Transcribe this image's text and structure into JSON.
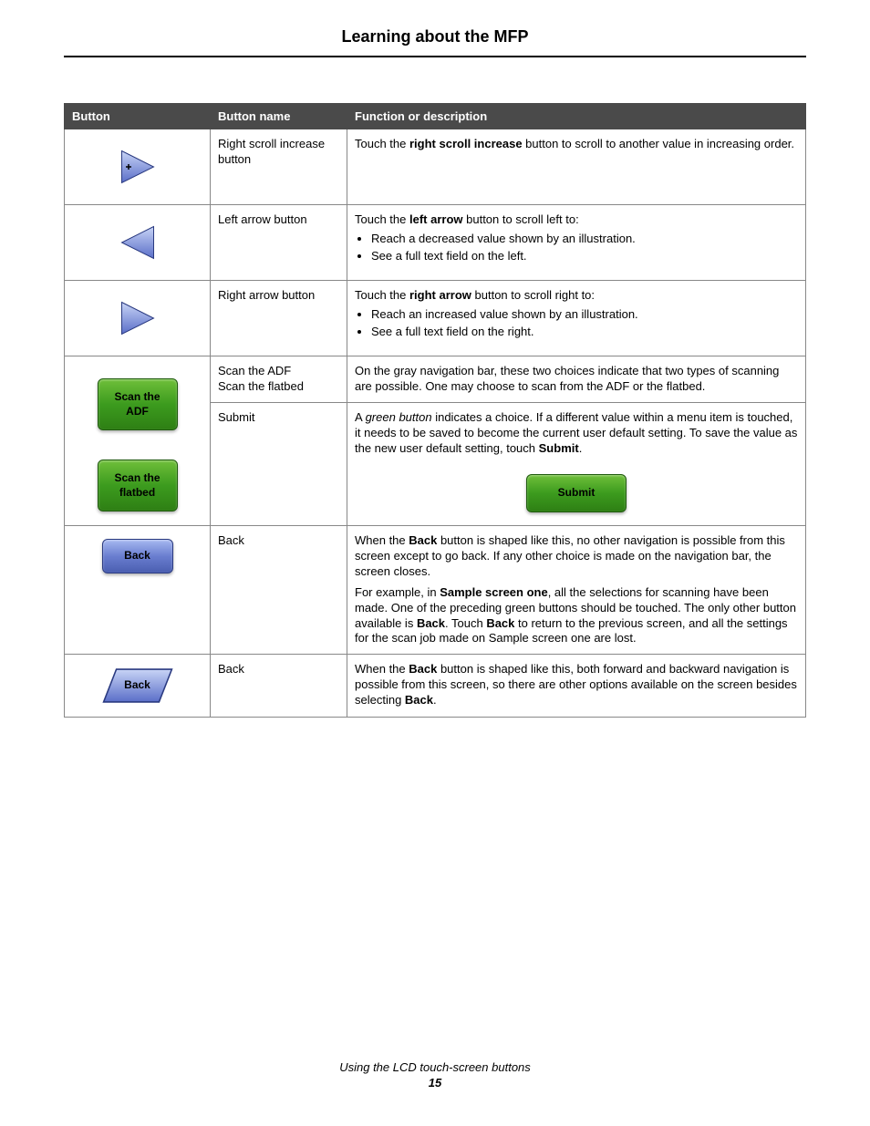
{
  "page_title": "Learning about the MFP",
  "footer": {
    "section": "Using the LCD touch-screen buttons",
    "page_number": "15"
  },
  "table": {
    "headers": {
      "c1": "Button",
      "c2": "Button name",
      "c3": "Function or description"
    },
    "rows": [
      {
        "name": "Right scroll increase button",
        "desc_pre": "Touch the ",
        "desc_bold": "right scroll increase",
        "desc_post": " button to scroll to another value in increasing order."
      },
      {
        "name": "Left arrow button",
        "desc_pre": "Touch the ",
        "desc_bold": "left arrow",
        "desc_post": " button to scroll left to:",
        "bullets": [
          "Reach a decreased value shown by an illustration.",
          "See a full text field on the left."
        ]
      },
      {
        "name": "Right arrow button",
        "desc_pre": "Touch the ",
        "desc_bold": "right arrow",
        "desc_post": " button to scroll right to:",
        "bullets": [
          "Reach an increased value shown by an illustration.",
          "See a full text field on the right."
        ]
      },
      {
        "icons": {
          "scan_adf": "Scan the ADF",
          "scan_flatbed": "Scan the flatbed"
        },
        "name_a": "Scan the ADF",
        "name_b": "Scan the flatbed",
        "desc_a": "On the gray navigation bar, these two choices indicate that two types of scanning are possible. One may choose to scan from the ADF or the flatbed.",
        "name_c": "Submit",
        "desc_c_pre": "A ",
        "desc_c_italic": "green button",
        "desc_c_mid": " indicates a choice. If a different value within a menu item is touched, it needs to be saved to become the current user default setting. To save the value as the new user default setting, touch ",
        "desc_c_bold": "Submit",
        "desc_c_post": ".",
        "submit_label": "Submit"
      },
      {
        "icon_label": "Back",
        "name": "Back",
        "p1_pre": "When the ",
        "p1_bold1": "Back",
        "p1_mid": " button is shaped like this, no other navigation is possible from this screen except to go back. If any other choice is made on the navigation bar, the screen closes.",
        "p2_pre": "For example, in ",
        "p2_bold1": "Sample screen one",
        "p2_mid1": ", all the selections for scanning have been made. One of the preceding green buttons should be touched. The only other button available is ",
        "p2_bold2": "Back",
        "p2_mid2": ". Touch ",
        "p2_bold3": "Back",
        "p2_post": " to return to the previous screen, and all the settings for the scan job made on Sample screen one are lost."
      },
      {
        "icon_label": "Back",
        "name": "Back",
        "p1_pre": "When the ",
        "p1_bold1": "Back",
        "p1_mid": " button is shaped like this, both forward and backward navigation is possible from this screen, so there are other options available on the screen besides selecting ",
        "p1_bold2": "Back",
        "p1_post": "."
      }
    ]
  }
}
